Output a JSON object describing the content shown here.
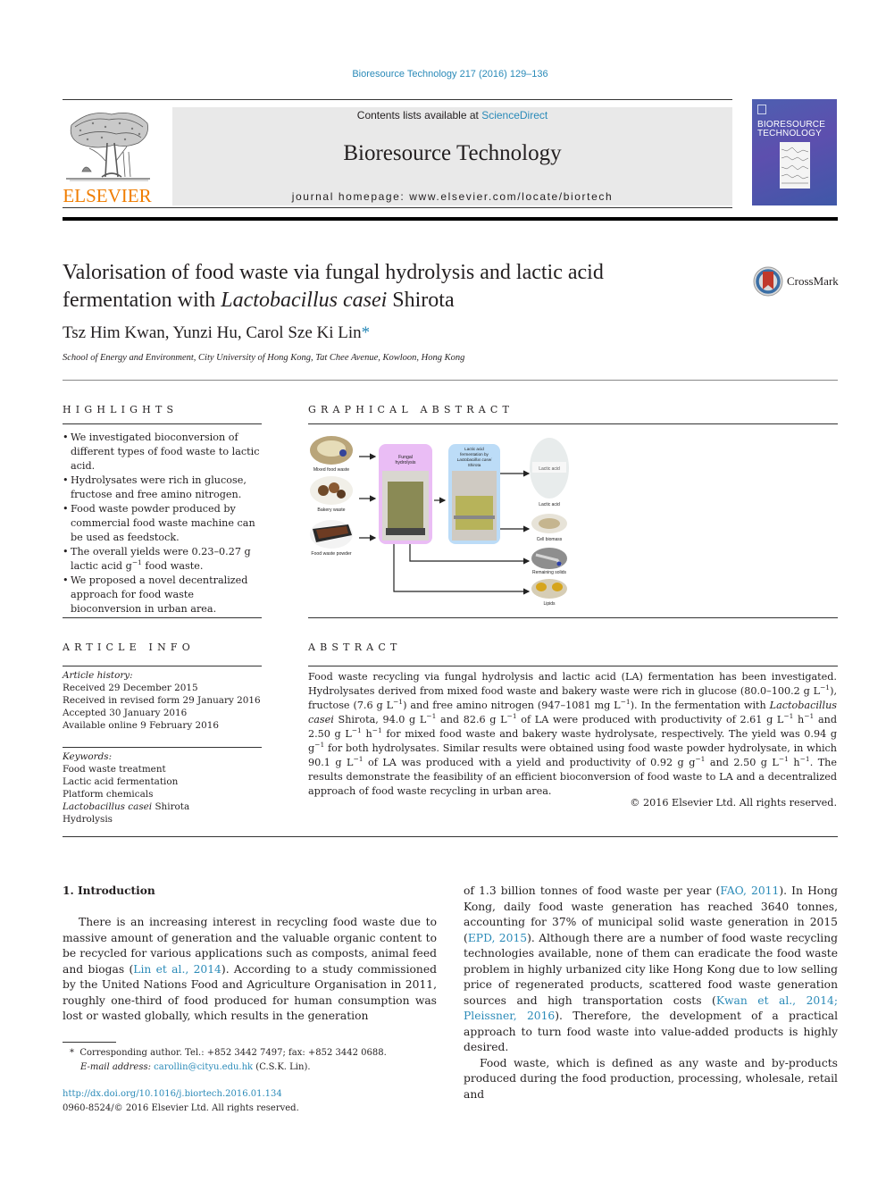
{
  "journal_ref": "Bioresource Technology 217 (2016) 129–136",
  "masthead": {
    "publisher_logo_text": "ELSEVIER",
    "contents_prefix": "Contents lists available at ",
    "contents_link": "ScienceDirect",
    "journal_title": "Bioresource Technology",
    "homepage": "journal homepage: www.elsevier.com/locate/biortech",
    "cover_title_line1": "BIORESOURCE",
    "cover_title_line2": "TECHNOLOGY"
  },
  "article": {
    "title_part1": "Valorisation of food waste via fungal hydrolysis and lactic acid fermentation with ",
    "title_italic": "Lactobacillus casei",
    "title_part2": " Shirota",
    "crossmark_label": "CrossMark",
    "authors": "Tsz Him Kwan, Yunzi Hu, Carol Sze Ki Lin",
    "author_marker": "*",
    "affiliation": "School of Energy and Environment, City University of Hong Kong, Tat Chee Avenue, Kowloon, Hong Kong"
  },
  "highlights": {
    "heading": "HIGHLIGHTS",
    "items": [
      "We investigated bioconversion of different types of food waste to lactic acid.",
      "Hydrolysates were rich in glucose, fructose and free amino nitrogen.",
      "Food waste powder produced by commercial food waste machine can be used as feedstock.",
      "The overall yields were 0.23–0.27 g lactic acid g",
      "We proposed a novel decentralized approach for food waste bioconversion in urban area."
    ],
    "item4_sup": "−1",
    "item4_tail": " food waste."
  },
  "graphical_abstract": {
    "heading": "GRAPHICAL ABSTRACT",
    "inputs": [
      "Mixed food waste",
      "Bakery waste",
      "Food waste powder"
    ],
    "step1_line1": "Fungal",
    "step1_line2": "hydrolysis",
    "step2_line1": "Lactic acid",
    "step2_line2": "fermentation by",
    "step2_line3": "Lactobacillus casei",
    "step2_line4": "Shirota",
    "outputs": [
      "Lactic acid",
      "Cell biomass",
      "Remaining solids",
      "Lipids"
    ],
    "jar_label": "Lactic acid",
    "colors": {
      "step1_box": "#eabdf5",
      "step2_box": "#bcdcf7"
    }
  },
  "article_info": {
    "heading": "ARTICLE INFO",
    "history_label": "Article history:",
    "history": [
      "Received 29 December 2015",
      "Received in revised form 29 January 2016",
      "Accepted 30 January 2016",
      "Available online 9 February 2016"
    ],
    "keywords_label": "Keywords:",
    "keywords": [
      "Food waste treatment",
      "Lactic acid fermentation",
      "Platform chemicals",
      "Lactobacillus casei",
      "Hydrolysis"
    ],
    "keyword4_tail": " Shirota"
  },
  "abstract": {
    "heading": "ABSTRACT",
    "s1": "Food waste recycling via fungal hydrolysis and lactic acid (LA) fermentation has been investigated. Hydrolysates derived from mixed food waste and bakery waste were rich in glucose (80.0–100.2 g L",
    "s2": "), fructose (7.6 g L",
    "s3": ") and free amino nitrogen (947–1081 mg L",
    "s4": "). In the fermentation with ",
    "s5_italic": "Lactobacillus casei",
    "s6": " Shirota, 94.0 g L",
    "s7": " and 82.6 g L",
    "s8": " of LA were produced with productivity of 2.61 g L",
    "s9": " h",
    "s10": " and 2.50 g L",
    "s11": " h",
    "s12": " for mixed food waste and bakery waste hydrolysate, respectively. The yield was 0.94 g g",
    "s13": " for both hydrolysates. Similar results were obtained using food waste powder hydrolysate, in which 90.1 g L",
    "s14": " of LA was produced with a yield and productivity of 0.92 g g",
    "s15": " and 2.50 g L",
    "s16": " h",
    "s17": ". The results demonstrate the feasibility of an efficient bioconversion of food waste to LA and a decentralized approach of food waste recycling in urban area.",
    "sup": "−1",
    "copyright": "© 2016 Elsevier Ltd. All rights reserved."
  },
  "intro": {
    "heading": "1. Introduction",
    "p1_a": "There is an increasing interest in recycling food waste due to massive amount of generation and the valuable organic content to be recycled for various applications such as composts, animal feed and biogas (",
    "p1_ref1": "Lin et al., 2014",
    "p1_b": "). According to a study commissioned by the United Nations Food and Agriculture Organisation in 2011, roughly one-third of food produced for human consumption was lost or wasted globally, which results in the generation of 1.3 billion tonnes of food waste per year (",
    "p1_ref2": "FAO, 2011",
    "p1_c": "). In Hong Kong, daily food waste generation has reached 3640 tonnes, accounting for 37% of municipal solid waste generation in 2015 (",
    "p1_ref3": "EPD, 2015",
    "p1_d": "). Although there are a number of food waste recycling technologies available, none of them can eradicate the food waste problem in highly urbanized city like Hong Kong due to low selling price of regenerated products, scattered food waste generation sources and high transportation costs (",
    "p1_ref4": "Kwan et al., 2014; Pleissner, 2016",
    "p1_e": "). Therefore, the development of a practical approach to turn food waste into value-added products is highly desired.",
    "p2": "Food waste, which is defined as any waste and by-products produced during the food production, processing, wholesale, retail and"
  },
  "footnote": {
    "marker": "*",
    "corresponding": "Corresponding author. Tel.: +852 3442 7497; fax: +852 3442 0688.",
    "email_label": "E-mail address: ",
    "email": "carollin@cityu.edu.hk",
    "email_tail": " (C.S.K. Lin)."
  },
  "doi": {
    "url": "http://dx.doi.org/10.1016/j.biortech.2016.01.134",
    "issn_line": "0960-8524/© 2016 Elsevier Ltd. All rights reserved."
  }
}
